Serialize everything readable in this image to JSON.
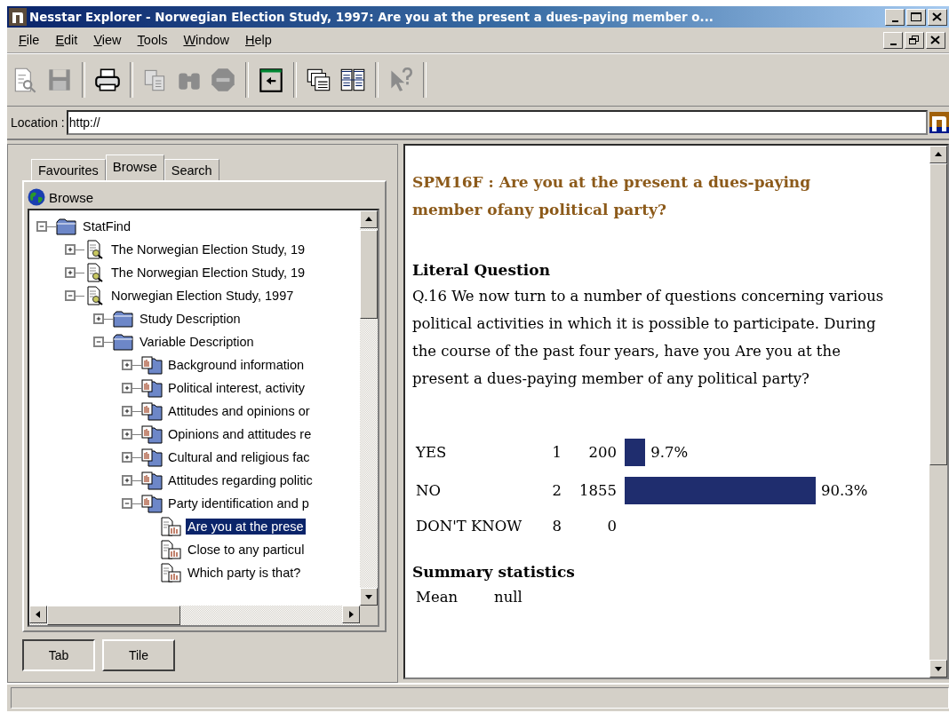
{
  "window": {
    "title": "Nesstar Explorer - Norwegian Election Study, 1997: Are you at the present a dues-paying member o..."
  },
  "menu": [
    "File",
    "Edit",
    "View",
    "Tools",
    "Window",
    "Help"
  ],
  "toolbar": [
    {
      "kind": "preview",
      "disabled": true
    },
    {
      "kind": "save",
      "disabled": true
    },
    {
      "kind": "separator"
    },
    {
      "kind": "print",
      "disabled": false
    },
    {
      "kind": "separator"
    },
    {
      "kind": "copy",
      "disabled": true
    },
    {
      "kind": "find",
      "disabled": true
    },
    {
      "kind": "stop",
      "disabled": true
    },
    {
      "kind": "separator"
    },
    {
      "kind": "back",
      "disabled": false
    },
    {
      "kind": "separator"
    },
    {
      "kind": "cascade",
      "disabled": false
    },
    {
      "kind": "tile",
      "disabled": false
    },
    {
      "kind": "separator"
    },
    {
      "kind": "help",
      "disabled": true
    },
    {
      "kind": "separator"
    }
  ],
  "location": {
    "label": "Location :",
    "value": "http://"
  },
  "left_panel": {
    "tabs": [
      {
        "label": "Favourites",
        "selected": false
      },
      {
        "label": "Browse",
        "selected": true
      },
      {
        "label": "Search",
        "selected": false
      }
    ],
    "header": "Browse",
    "tree": [
      {
        "label": "StatFind",
        "kind": "folder",
        "expanded": true,
        "selected": false,
        "children": [
          {
            "label": "The Norwegian Election Study, 19",
            "kind": "study",
            "expanded": false,
            "selected": false
          },
          {
            "label": "The Norwegian Election Study, 19",
            "kind": "study",
            "expanded": false,
            "selected": false
          },
          {
            "label": "Norwegian Election Study, 1997",
            "kind": "study",
            "expanded": true,
            "selected": false,
            "children": [
              {
                "label": "Study Description",
                "kind": "folder",
                "expanded": false,
                "selected": false
              },
              {
                "label": "Variable Description",
                "kind": "folder",
                "expanded": true,
                "selected": false,
                "children": [
                  {
                    "label": "Background information",
                    "kind": "group",
                    "expanded": false,
                    "selected": false
                  },
                  {
                    "label": "Political interest, activity",
                    "kind": "group",
                    "expanded": false,
                    "selected": false
                  },
                  {
                    "label": "Attitudes and opinions or",
                    "kind": "group",
                    "expanded": false,
                    "selected": false
                  },
                  {
                    "label": "Opinions and attitudes re",
                    "kind": "group",
                    "expanded": false,
                    "selected": false
                  },
                  {
                    "label": "Cultural and religious fac",
                    "kind": "group",
                    "expanded": false,
                    "selected": false
                  },
                  {
                    "label": "Attitudes regarding politic",
                    "kind": "group",
                    "expanded": false,
                    "selected": false
                  },
                  {
                    "label": "Party identification and p",
                    "kind": "group",
                    "expanded": true,
                    "selected": false,
                    "children": [
                      {
                        "label": "Are you at the prese",
                        "kind": "variable",
                        "selected": true
                      },
                      {
                        "label": "Close to any particul",
                        "kind": "variable",
                        "selected": false
                      },
                      {
                        "label": "Which party is that?",
                        "kind": "variable",
                        "selected": false
                      }
                    ]
                  }
                ]
              }
            ]
          }
        ]
      }
    ],
    "view_buttons": [
      {
        "label": "Tab",
        "selected": true
      },
      {
        "label": "Tile",
        "selected": false
      }
    ]
  },
  "right_panel": {
    "heading": "SPM16F : Are you at the present a dues-paying member ofany political party?",
    "literal_question": {
      "title": "Literal Question",
      "text": "Q.16 We now turn to a number of questions concerning various political activities in which it is possible to participate. During the course of the past four years, have you Are you at the present a dues-paying member of any political party?"
    },
    "frequencies": [
      {
        "label": "YES",
        "code": "1",
        "count": "200",
        "percent": "9.7%"
      },
      {
        "label": "NO",
        "code": "2",
        "count": "1855",
        "percent": "90.3%"
      },
      {
        "label": "DON'T KNOW",
        "code": "8",
        "count": "0"
      }
    ],
    "summary_statistics": {
      "title": "Summary statistics",
      "rows": [
        {
          "label": "Mean",
          "value": "null"
        }
      ]
    }
  }
}
